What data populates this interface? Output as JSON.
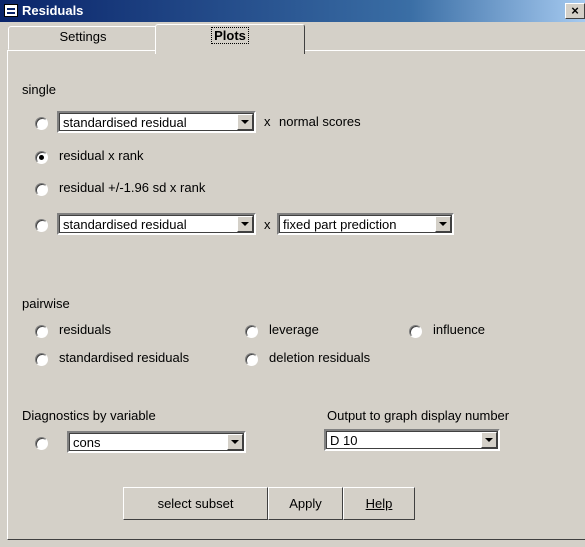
{
  "window": {
    "title": "Residuals",
    "close_label": "×"
  },
  "tabs": [
    {
      "label": "Settings"
    },
    {
      "label": "Plots"
    }
  ],
  "single": {
    "heading": "single",
    "row1": {
      "combo_value": "standardised residual",
      "x_label": "x",
      "suffix": "normal scores",
      "selected": false
    },
    "row2": {
      "label": "residual x rank",
      "selected": true
    },
    "row3": {
      "label": "residual +/-1.96 sd x  rank",
      "selected": false
    },
    "row4": {
      "combo_value": "standardised residual",
      "x_label": "x",
      "combo2_value": "fixed part prediction",
      "selected": false
    }
  },
  "pairwise": {
    "heading": "pairwise",
    "options": [
      {
        "label": "residuals",
        "selected": false
      },
      {
        "label": "leverage",
        "selected": false
      },
      {
        "label": "influence",
        "selected": false
      },
      {
        "label": "standardised residuals",
        "selected": false
      },
      {
        "label": "deletion residuals",
        "selected": false
      }
    ]
  },
  "diagnostics": {
    "heading": "Diagnostics by variable",
    "combo_value": "cons",
    "selected": false
  },
  "output": {
    "heading": "Output to graph display number",
    "combo_value": "D 10"
  },
  "buttons": {
    "select_subset": "select subset",
    "apply": "Apply",
    "help": "Help"
  }
}
